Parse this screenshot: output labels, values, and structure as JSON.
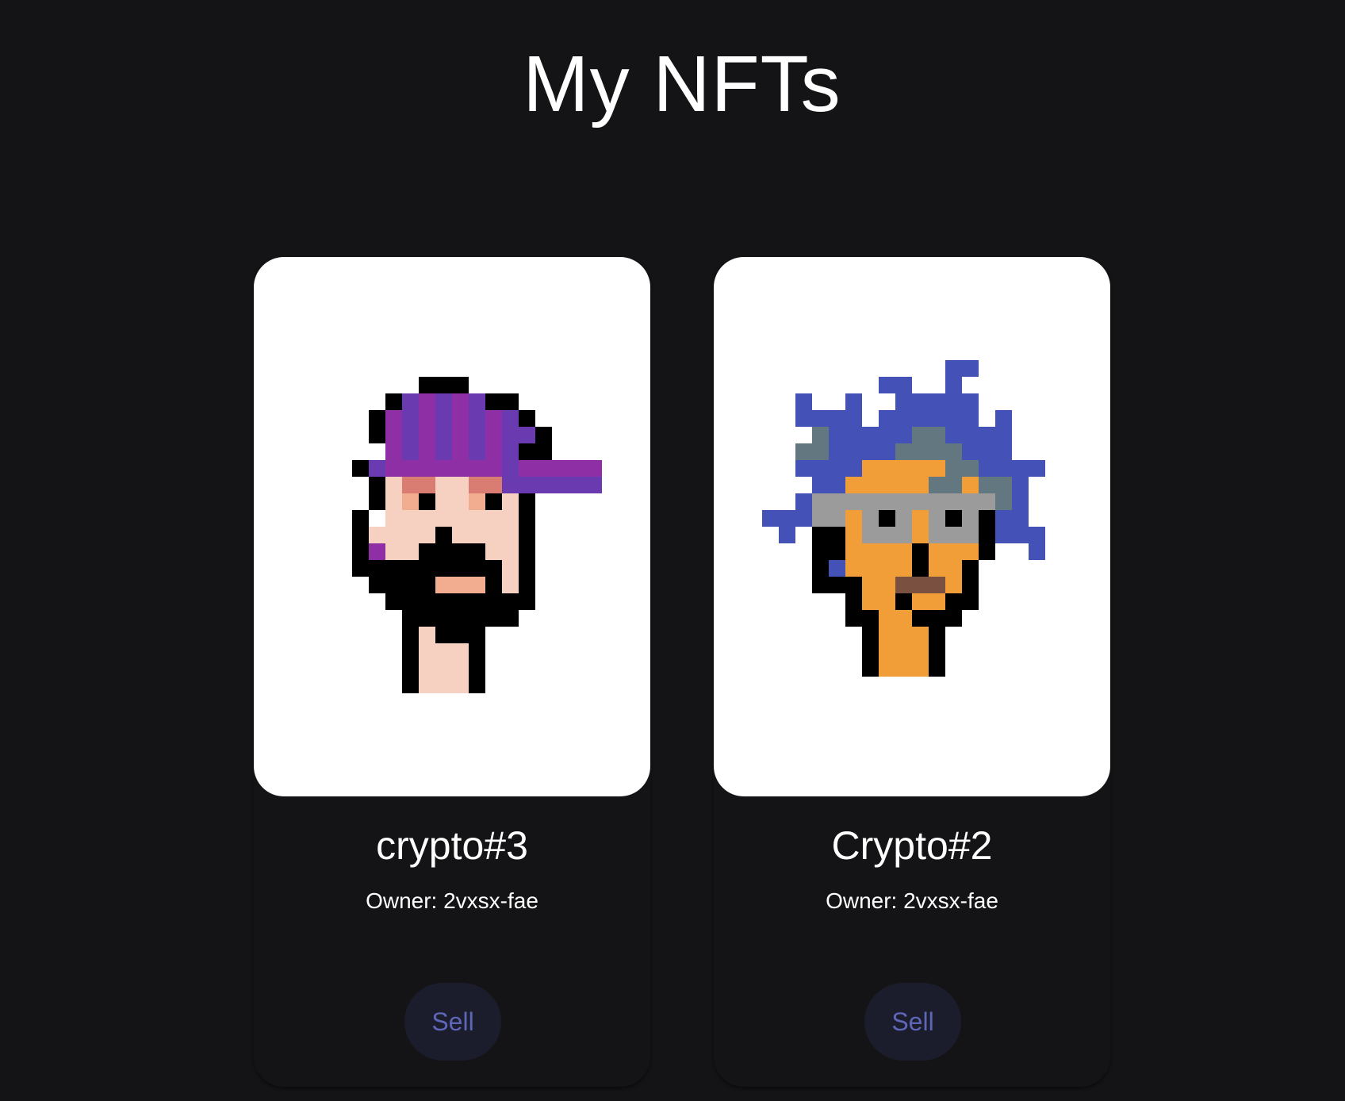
{
  "header": {
    "title": "My NFTs"
  },
  "nfts": [
    {
      "name": "crypto#3",
      "owner_label": "Owner: 2vxsx-fae",
      "sell_label": "Sell",
      "image_icon": "pixel-punk-purple-cap-beard"
    },
    {
      "name": "Crypto#2",
      "owner_label": "Owner: 2vxsx-fae",
      "sell_label": "Sell",
      "image_icon": "pixel-punk-blue-hair-glasses"
    }
  ],
  "colors": {
    "background": "#141416",
    "card_image_bg": "#ffffff",
    "sell_button_bg": "#1b1d2c",
    "sell_button_text": "#5e66b8",
    "text": "#ffffff"
  }
}
